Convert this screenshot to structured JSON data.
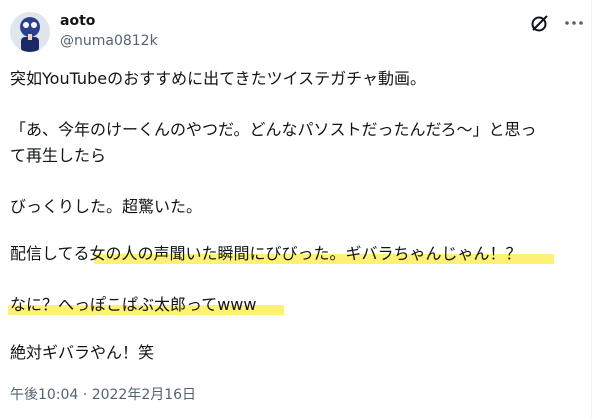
{
  "author": {
    "name": "aoto",
    "handle": "@numa0812k",
    "avatar_icon": "user-avatar-icon"
  },
  "actions": {
    "grok_icon": "grok-icon",
    "more_icon": "more-options-icon"
  },
  "tweet": {
    "lines": [
      "突如YouTubeのおすすめに出てきたツイステガチャ動画。",
      "「あ、今年のけーくんのやつだ。どんなパソストだったんだろ～」と思っ",
      "て再生したら",
      "びっくりした。超驚いた。",
      "配信してる女の人の声聞いた瞬間にびびった。ギバラちゃんじゃん！？",
      "なに？へっぽこぱぶ太郎ってwww",
      "絶対ギバラやん！笑"
    ],
    "highlight_color": "#fff176"
  },
  "meta": {
    "timestamp": "午後10:04 · 2022年2月16日"
  }
}
